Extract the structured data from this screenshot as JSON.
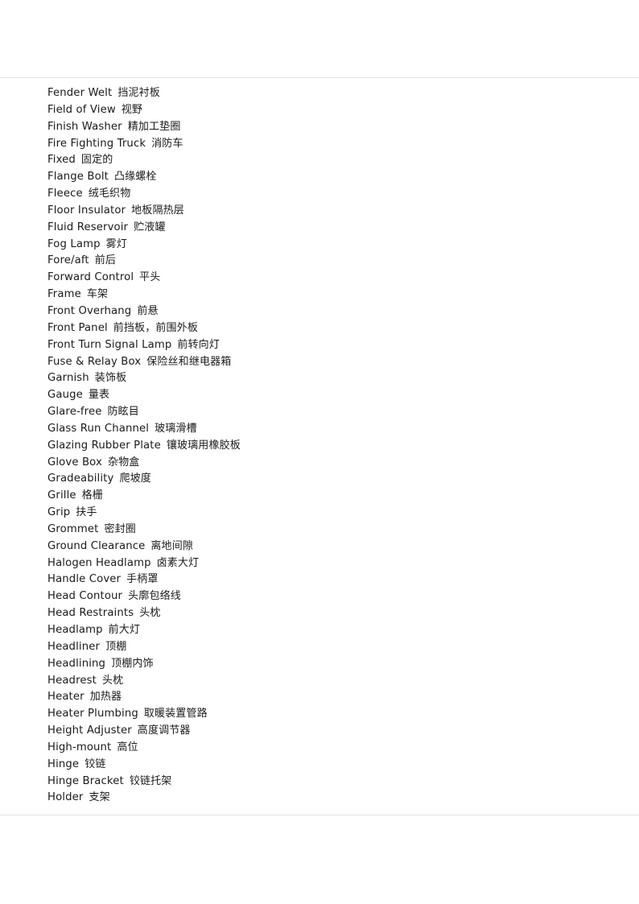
{
  "document": {
    "type": "glossary-page",
    "section": "F-H",
    "background_color": "#ffffff",
    "text_color": "#1a1a1a",
    "rule_color": "#e3e3e3",
    "entry_count": 44
  },
  "glossary": {
    "entries": [
      {
        "en": "Fender Welt",
        "zh": "挡泥衬板"
      },
      {
        "en": "Field of View",
        "zh": "视野"
      },
      {
        "en": "Finish Washer",
        "zh": "精加工垫圈"
      },
      {
        "en": "Fire Fighting Truck",
        "zh": "消防车"
      },
      {
        "en": "Fixed",
        "zh": "固定的"
      },
      {
        "en": "Flange Bolt",
        "zh": "凸缘螺栓"
      },
      {
        "en": "Fleece",
        "zh": "绒毛织物"
      },
      {
        "en": "Floor Insulator",
        "zh": "地板隔热层"
      },
      {
        "en": "Fluid Reservoir",
        "zh": "贮液罐"
      },
      {
        "en": "Fog Lamp",
        "zh": "雾灯"
      },
      {
        "en": "Fore/aft",
        "zh": "前后"
      },
      {
        "en": "Forward Control",
        "zh": "平头"
      },
      {
        "en": "Frame",
        "zh": "车架"
      },
      {
        "en": "Front Overhang",
        "zh": "前悬"
      },
      {
        "en": "Front Panel",
        "zh": "前挡板，前围外板"
      },
      {
        "en": "Front Turn Signal Lamp",
        "zh": "前转向灯"
      },
      {
        "en": "Fuse & Relay Box",
        "zh": "保险丝和继电器箱"
      },
      {
        "en": "Garnish",
        "zh": "装饰板"
      },
      {
        "en": "Gauge",
        "zh": "量表"
      },
      {
        "en": "Glare-free",
        "zh": "防眩目"
      },
      {
        "en": "Glass Run Channel",
        "zh": "玻璃滑槽"
      },
      {
        "en": "Glazing Rubber Plate",
        "zh": "镶玻璃用橡胶板"
      },
      {
        "en": "Glove Box",
        "zh": "杂物盒"
      },
      {
        "en": "Gradeability",
        "zh": "爬坡度"
      },
      {
        "en": "Grille",
        "zh": "格栅"
      },
      {
        "en": "Grip",
        "zh": "扶手"
      },
      {
        "en": "Grommet",
        "zh": "密封圈"
      },
      {
        "en": "Ground Clearance",
        "zh": "离地间隙"
      },
      {
        "en": "Halogen Headlamp",
        "zh": "卤素大灯"
      },
      {
        "en": "Handle Cover",
        "zh": "手柄罩"
      },
      {
        "en": "Head Contour",
        "zh": "头廓包络线"
      },
      {
        "en": "Head Restraints",
        "zh": "头枕"
      },
      {
        "en": "Headlamp",
        "zh": "前大灯"
      },
      {
        "en": "Headliner",
        "zh": "顶棚"
      },
      {
        "en": "Headlining",
        "zh": "顶棚内饰"
      },
      {
        "en": "Headrest",
        "zh": "头枕"
      },
      {
        "en": "Heater",
        "zh": "加热器"
      },
      {
        "en": "Heater Plumbing",
        "zh": "取暖装置管路"
      },
      {
        "en": "Height Adjuster",
        "zh": "高度调节器"
      },
      {
        "en": "High-mount",
        "zh": "高位"
      },
      {
        "en": "Hinge",
        "zh": "铰链"
      },
      {
        "en": "Hinge Bracket",
        "zh": "铰链托架"
      },
      {
        "en": "Holder",
        "zh": "支架"
      }
    ]
  }
}
